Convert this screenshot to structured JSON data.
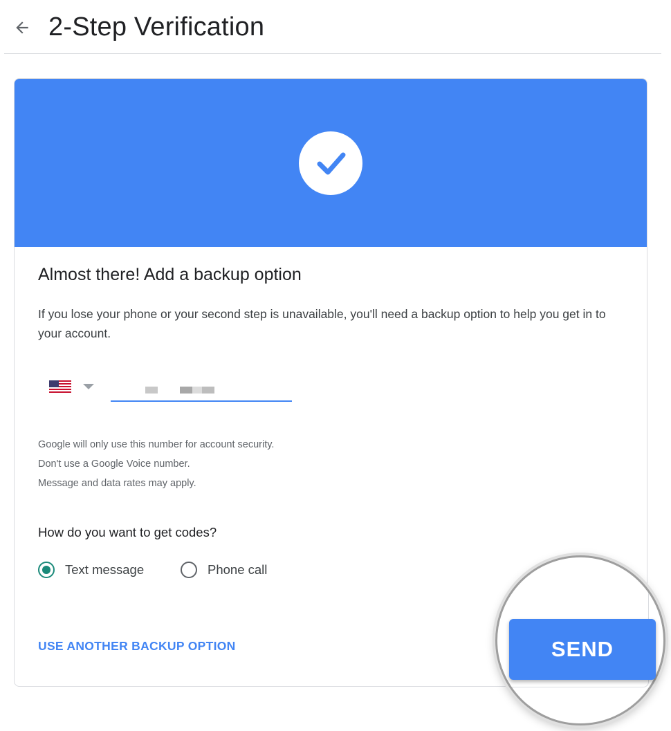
{
  "header": {
    "back_icon": "arrow-left-icon",
    "title": "2-Step Verification"
  },
  "banner": {
    "color": "#4285f4",
    "icon": "check-circle-icon"
  },
  "card": {
    "title": "Almost there! Add a backup option",
    "description": "If you lose your phone or your second step is unavailable, you'll need a backup option to help you get in to your account."
  },
  "phone": {
    "country_flag_icon": "us-flag-icon",
    "country_dropdown_icon": "caret-down-icon",
    "value": "",
    "value_redacted": true
  },
  "notes": {
    "line1": "Google will only use this number for account security.",
    "line2": "Don't use a Google Voice number.",
    "line3": "Message and data rates may apply."
  },
  "codes": {
    "question": "How do you want to get codes?",
    "options": [
      {
        "label": "Text message",
        "selected": true
      },
      {
        "label": "Phone call",
        "selected": false
      }
    ],
    "selected_color": "#1a8a7a"
  },
  "actions": {
    "other_option_label": "USE ANOTHER BACKUP OPTION",
    "send_label": "SEND",
    "accent": "#4285f4"
  }
}
